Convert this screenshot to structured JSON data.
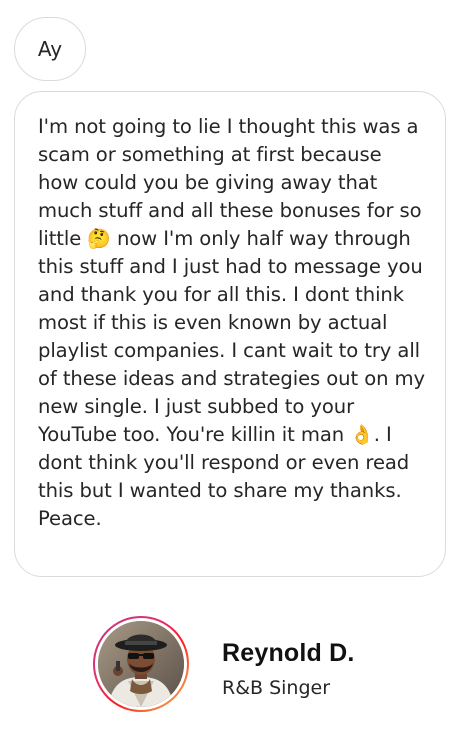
{
  "messages": {
    "first": "Ay",
    "second_part1": "I'm not going to lie I thought this was a scam or something at first because how could you be giving away that much stuff and all these bonuses for so little ",
    "second_emoji1": "🤔",
    "second_part2": " now I'm only half way through this stuff and I just had to message you and thank you for all this. I dont think most if this is even known by actual playlist companies. I cant wait to try all of these ideas and strategies out on my new single. I just subbed to your YouTube too. You're killin it man ",
    "second_emoji2": "👌",
    "second_part3": ". I dont think you'll respond or even read this but I wanted to share my thanks. Peace."
  },
  "testimonial": {
    "name": "Reynold D.",
    "role": "R&B Singer"
  }
}
